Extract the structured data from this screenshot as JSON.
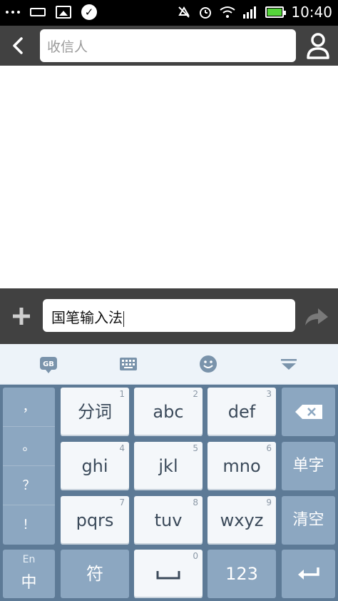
{
  "status_bar": {
    "time": "10:40",
    "icons": [
      "more-dots-icon",
      "keyboard-icon",
      "image-icon",
      "check-circle-icon",
      "mute-icon",
      "alarm-icon",
      "wifi-icon",
      "signal-icon",
      "battery-icon"
    ]
  },
  "header": {
    "recipient_placeholder": "收信人"
  },
  "compose": {
    "text": "国笔输入法"
  },
  "ime_toolbar": {
    "items": [
      "gb-logo-icon",
      "keyboard-icon",
      "emoji-icon",
      "hide-keyboard-icon"
    ]
  },
  "keyboard": {
    "punctuation": [
      "，",
      "。",
      "？",
      "！"
    ],
    "keys": {
      "k1": {
        "label": "分词",
        "num": "1"
      },
      "k2": {
        "label": "abc",
        "num": "2"
      },
      "k3": {
        "label": "def",
        "num": "3"
      },
      "k4": {
        "label": "ghi",
        "num": "4"
      },
      "k5": {
        "label": "jkl",
        "num": "5"
      },
      "k6": {
        "label": "mno",
        "num": "6"
      },
      "k7": {
        "label": "pqrs",
        "num": "7"
      },
      "k8": {
        "label": "tuv",
        "num": "8"
      },
      "k9": {
        "label": "wxyz",
        "num": "9"
      },
      "k0": {
        "label": "␣",
        "num": "0"
      }
    },
    "single_char": "单字",
    "clear": "清空",
    "lang_small": "En",
    "lang_big": "中",
    "symbol": "符",
    "numbers": "123"
  },
  "colors": {
    "bar_bg": "#414141",
    "key_light": "#f4f7fa",
    "key_dark": "#8ca7c1",
    "keyboard_bg": "#5d7a96",
    "battery": "#55d43a"
  }
}
